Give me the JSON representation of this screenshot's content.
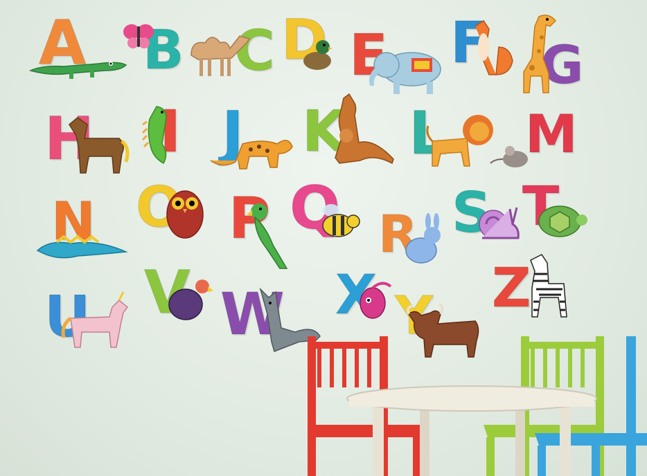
{
  "letters": [
    {
      "char": "A",
      "color": "#f08a3a"
    },
    {
      "char": "B",
      "color": "#2bb3a8"
    },
    {
      "char": "C",
      "color": "#8cc63f"
    },
    {
      "char": "D",
      "color": "#f3c52e"
    },
    {
      "char": "E",
      "color": "#e84b3c"
    },
    {
      "char": "F",
      "color": "#2f8ed0"
    },
    {
      "char": "G",
      "color": "#8b4dab"
    },
    {
      "char": "H",
      "color": "#ea4f7a"
    },
    {
      "char": "I",
      "color": "#e8493c"
    },
    {
      "char": "J",
      "color": "#2b9fd6"
    },
    {
      "char": "K",
      "color": "#8cc63f"
    },
    {
      "char": "L",
      "color": "#30b3a0"
    },
    {
      "char": "M",
      "color": "#e23a4a"
    },
    {
      "char": "N",
      "color": "#f07a2e"
    },
    {
      "char": "O",
      "color": "#f2c92c"
    },
    {
      "char": "P",
      "color": "#e8493c"
    },
    {
      "char": "Q",
      "color": "#e8488e"
    },
    {
      "char": "R",
      "color": "#ef8a3a"
    },
    {
      "char": "S",
      "color": "#2bb3a8"
    },
    {
      "char": "T",
      "color": "#e23a5a"
    },
    {
      "char": "U",
      "color": "#3a8fd6"
    },
    {
      "char": "V",
      "color": "#8cc63f"
    },
    {
      "char": "W",
      "color": "#8b4dab"
    },
    {
      "char": "X",
      "color": "#2b9fd6"
    },
    {
      "char": "Y",
      "color": "#f2d02c"
    },
    {
      "char": "Z",
      "color": "#e8493c"
    }
  ],
  "animals": [
    {
      "name": "crocodile-icon",
      "color": "#3fa34d"
    },
    {
      "name": "butterfly-icon",
      "color": "#e84b8a"
    },
    {
      "name": "camel-icon",
      "color": "#d9a877"
    },
    {
      "name": "duck-icon",
      "color": "#5a7a3a"
    },
    {
      "name": "elephant-icon",
      "color": "#a8cde0"
    },
    {
      "name": "fox-icon",
      "color": "#f07a2e"
    },
    {
      "name": "giraffe-icon",
      "color": "#f2a93b"
    },
    {
      "name": "horse-icon",
      "color": "#8b5a2b"
    },
    {
      "name": "iguana-icon",
      "color": "#5cbd3e"
    },
    {
      "name": "jaguar-icon",
      "color": "#f0a030"
    },
    {
      "name": "kangaroo-icon",
      "color": "#c9742f"
    },
    {
      "name": "lion-icon",
      "color": "#f2a93b"
    },
    {
      "name": "mouse-icon",
      "color": "#9a8f88"
    },
    {
      "name": "newt-icon",
      "color": "#2fa8c9"
    },
    {
      "name": "owl-icon",
      "color": "#b0342a"
    },
    {
      "name": "parrot-icon",
      "color": "#4cb04a"
    },
    {
      "name": "queen-bee-icon",
      "color": "#f2cf2c"
    },
    {
      "name": "rabbit-icon",
      "color": "#8fb6e8"
    },
    {
      "name": "snail-icon",
      "color": "#c88ad6"
    },
    {
      "name": "turtle-icon",
      "color": "#6ab04c"
    },
    {
      "name": "unicorn-icon",
      "color": "#f3c2cf"
    },
    {
      "name": "vulture-icon",
      "color": "#5a3a7a"
    },
    {
      "name": "wolf-icon",
      "color": "#7f8a90"
    },
    {
      "name": "xiphias-fish-icon",
      "color": "#d83a8a"
    },
    {
      "name": "yak-icon",
      "color": "#8b4a2b"
    },
    {
      "name": "zebra-icon",
      "color": "#333333"
    }
  ],
  "furniture": {
    "chair_red": "#e23a2f",
    "chair_green": "#9ccc3c",
    "chair_blue": "#3aa4dc",
    "table": "#f1ece0"
  }
}
